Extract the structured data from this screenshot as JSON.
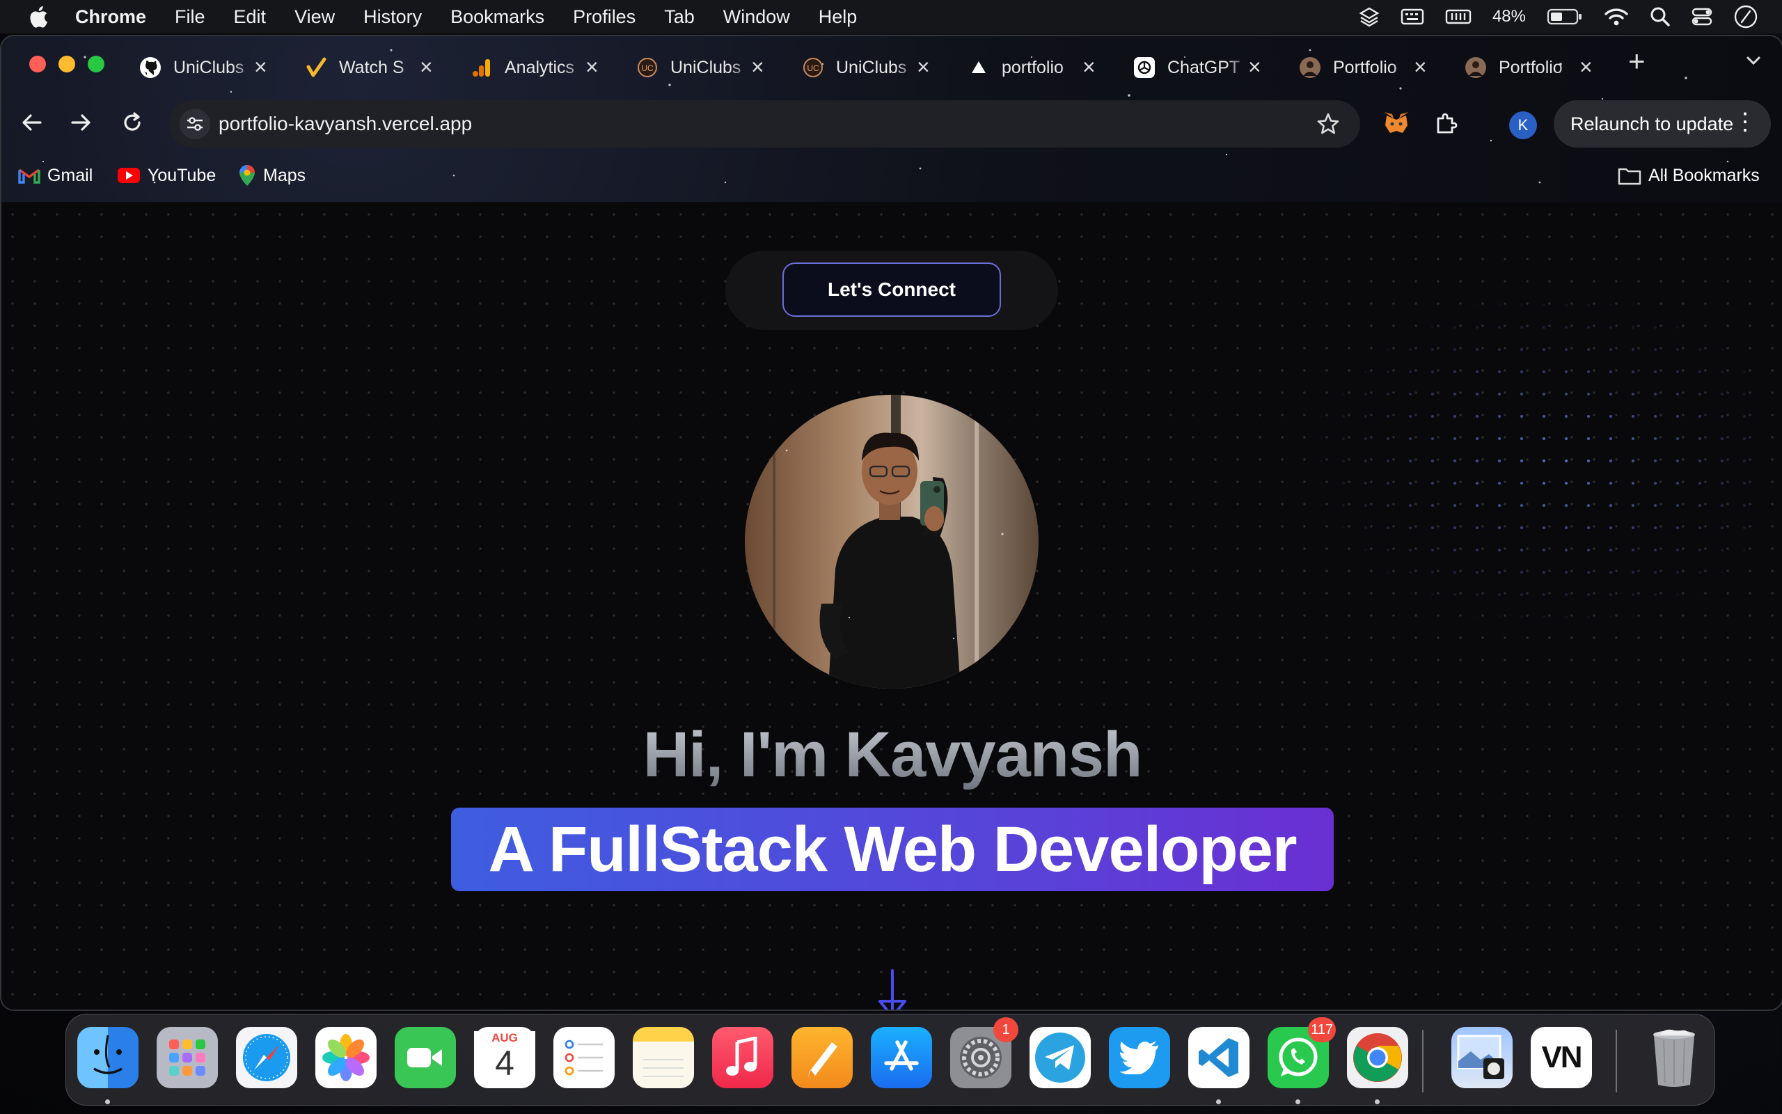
{
  "menubar": {
    "app": "Chrome",
    "items": [
      "File",
      "Edit",
      "View",
      "History",
      "Bookmarks",
      "Profiles",
      "Tab",
      "Window",
      "Help"
    ],
    "battery": "48%"
  },
  "tabs": [
    {
      "label": "UniClubs",
      "icon": "github-icon"
    },
    {
      "label": "Watch S",
      "icon": "check-icon"
    },
    {
      "label": "Analytics",
      "icon": "analytics-icon"
    },
    {
      "label": "UniClubs",
      "icon": "uniclubs-icon"
    },
    {
      "label": "UniClubs",
      "icon": "uniclubs-icon"
    },
    {
      "label": "portfolio",
      "icon": "vercel-icon"
    },
    {
      "label": "ChatGPT",
      "icon": "chatgpt-icon"
    },
    {
      "label": "Portfolio",
      "icon": "profile-icon"
    },
    {
      "label": "Portfolio",
      "icon": "profile-icon"
    }
  ],
  "omnibox": {
    "url": "portfolio-kavyansh.vercel.app"
  },
  "toolbar": {
    "relaunch": "Relaunch to update",
    "avatar_letter": "K"
  },
  "bookmarks": {
    "items": [
      {
        "label": "Gmail",
        "icon": "gmail-icon"
      },
      {
        "label": "YouTube",
        "icon": "youtube-icon"
      },
      {
        "label": "Maps",
        "icon": "maps-icon"
      }
    ],
    "all": "All Bookmarks"
  },
  "page": {
    "connect": "Let's Connect",
    "greeting": "Hi, I'm Kavyansh",
    "role": "A FullStack Web Developer"
  },
  "dock": {
    "calendar_month": "AUG",
    "calendar_day": "4",
    "settings_badge": "1",
    "whatsapp_badge": "117",
    "vn_label": "VN"
  },
  "colors": {
    "accent_gradient_start": "#3f5de0",
    "accent_gradient_end": "#6a2fd2",
    "connect_border": "#6b6fd8",
    "page_background": "#09090b"
  }
}
